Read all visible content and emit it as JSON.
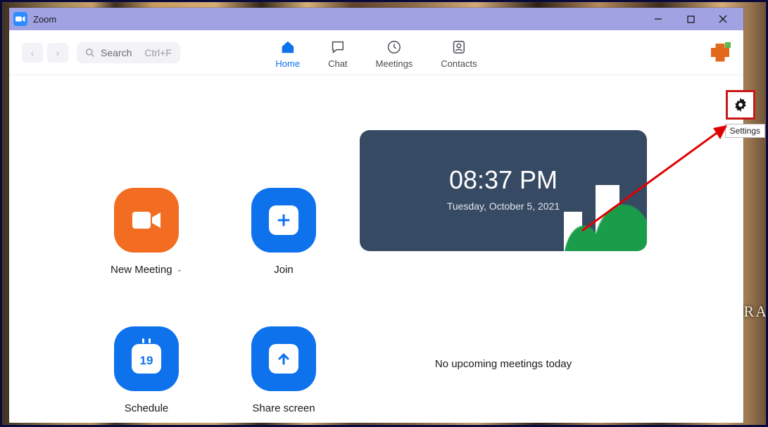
{
  "titlebar": {
    "app": "Zoom"
  },
  "header": {
    "search_label": "Search",
    "search_hint": "Ctrl+F",
    "tabs": {
      "home": "Home",
      "chat": "Chat",
      "meetings": "Meetings",
      "contacts": "Contacts"
    }
  },
  "actions": {
    "new_meeting": "New Meeting",
    "join": "Join",
    "schedule": "Schedule",
    "share": "Share screen",
    "calendar_day": "19"
  },
  "clock": {
    "time": "08:37 PM",
    "date": "Tuesday, October 5, 2021"
  },
  "status": {
    "no_meetings": "No upcoming meetings today"
  },
  "annotation": {
    "tooltip": "Settings"
  },
  "edge_text": "RA"
}
